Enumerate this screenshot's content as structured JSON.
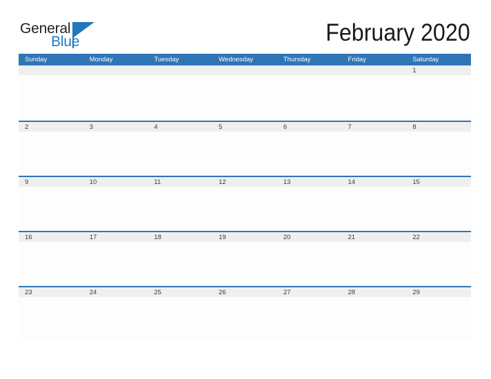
{
  "brand": {
    "name_top": "General",
    "name_bottom": "Blue",
    "color_dark": "#231f20",
    "color_blue": "#1f7bc1"
  },
  "header": {
    "title": "February 2020"
  },
  "calendar": {
    "month": "February",
    "year": "2020",
    "accent_color": "#2e75b6",
    "date_band_color": "#efefef",
    "weekday_headers": [
      "Sunday",
      "Monday",
      "Tuesday",
      "Wednesday",
      "Thursday",
      "Friday",
      "Saturday"
    ],
    "weeks": [
      {
        "days": [
          "",
          "",
          "",
          "",
          "",
          "",
          "1"
        ]
      },
      {
        "days": [
          "2",
          "3",
          "4",
          "5",
          "6",
          "7",
          "8"
        ]
      },
      {
        "days": [
          "9",
          "10",
          "11",
          "12",
          "13",
          "14",
          "15"
        ]
      },
      {
        "days": [
          "16",
          "17",
          "18",
          "19",
          "20",
          "21",
          "22"
        ]
      },
      {
        "days": [
          "23",
          "24",
          "25",
          "26",
          "27",
          "28",
          "29"
        ]
      },
      {
        "days": [
          "",
          "",
          "",
          "",
          "",
          "",
          ""
        ]
      }
    ]
  }
}
